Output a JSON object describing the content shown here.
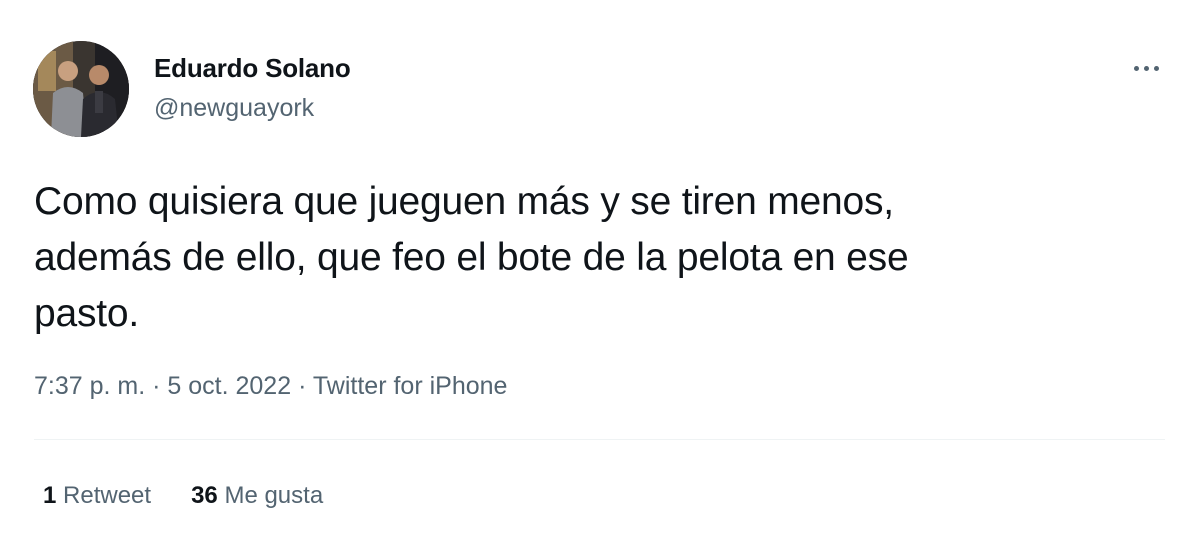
{
  "author": {
    "name": "Eduardo Solano",
    "handle": "@newguayork"
  },
  "tweet": {
    "line1": "Como quisiera que jueguen más y se tiren menos,",
    "line2": "además de ello, que feo el bote de la pelota en ese",
    "line3": "pasto."
  },
  "meta": {
    "time": "7:37 p. m.",
    "date": "5 oct. 2022",
    "source": "Twitter for iPhone",
    "separator": "·"
  },
  "stats": {
    "retweets_count": "1",
    "retweets_label": "Retweet",
    "likes_count": "36",
    "likes_label": "Me gusta"
  },
  "icons": {
    "more": "more-horizontal-icon"
  },
  "colors": {
    "text_primary": "#0f1419",
    "text_secondary": "#536471",
    "divider": "#eff3f4",
    "background": "#ffffff"
  }
}
